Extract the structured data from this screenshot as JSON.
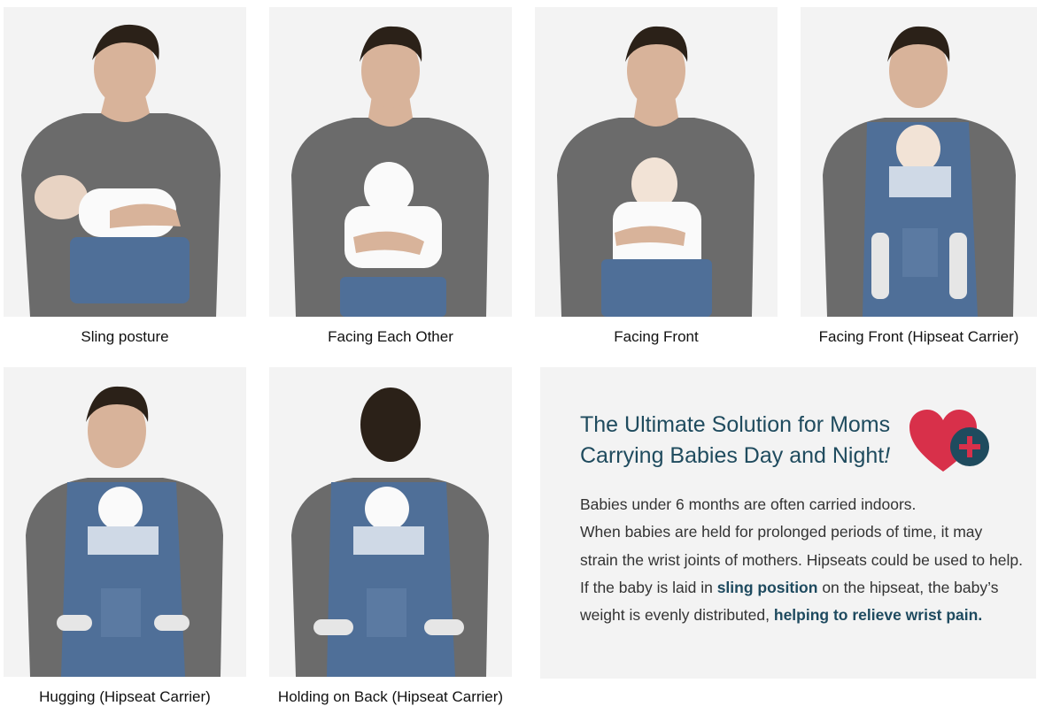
{
  "tiles": [
    {
      "caption": "Sling posture"
    },
    {
      "caption": "Facing Each Other"
    },
    {
      "caption": "Facing Front"
    },
    {
      "caption": "Facing Front (Hipseat Carrier)"
    },
    {
      "caption": "Hugging (Hipseat Carrier)"
    },
    {
      "caption": "Holding on Back (Hipseat Carrier)"
    }
  ],
  "info": {
    "title_line1": "The Ultimate Solution for Moms",
    "title_line2": "Carrying Babies Day and Night",
    "title_bang": "!",
    "body": {
      "p1": "Babies under 6 months are often carried indoors.",
      "p2": "When babies are held for prolonged periods of time, it may strain the wrist joints of mothers. Hipseats could be used to help. If the baby is laid in",
      "bold1": "sling position",
      "p3": "on the hipseat, the baby’s weight is evenly distributed,",
      "bold2": "helping to relieve wrist pain."
    }
  },
  "colors": {
    "heart": "#d8304a",
    "badge": "#1f4b5e",
    "sweater": "#6b6b6b",
    "carrier": "#4f6f98",
    "title": "#1f4b5e"
  },
  "icons": {
    "heart": "heart-plus-icon"
  }
}
